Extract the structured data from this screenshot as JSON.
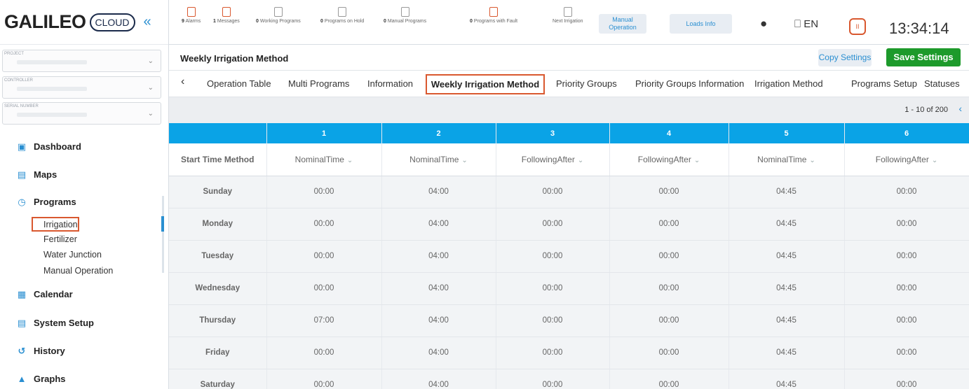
{
  "brand": {
    "name": "GALILEO",
    "cloud": "CLOUD",
    "collapse": "«"
  },
  "selectors": [
    {
      "label": "PROJECT"
    },
    {
      "label": "CONTROLLER"
    },
    {
      "label": "SERIAL NUMBER"
    }
  ],
  "nav": {
    "dashboard": "Dashboard",
    "maps": "Maps",
    "programs": "Programs",
    "irrigation": "Irrigation",
    "fertilizer": "Fertilizer",
    "water_junction": "Water Junction",
    "manual_operation": "Manual Operation",
    "calendar": "Calendar",
    "system_setup": "System Setup",
    "history": "History",
    "graphs": "Graphs"
  },
  "topbar": {
    "alarms": {
      "count": "9",
      "label": "Alarms"
    },
    "messages": {
      "count": "1",
      "label": "Messages"
    },
    "working": {
      "count": "0",
      "label": "Working Programs"
    },
    "on_hold": {
      "count": "0",
      "label": "Programs on Hold"
    },
    "manual_programs": {
      "count": "0",
      "label": "Manual Programs"
    },
    "fault": {
      "count": "0",
      "label": "Programs with Fault"
    },
    "next_irrigation": {
      "label": "Next Irrigation"
    },
    "manual_operation_btn": "Manual Operation",
    "loads_info_btn": "Loads Info",
    "language": "EN",
    "clock": "13:34:14"
  },
  "page": {
    "title": "Weekly Irrigation Method",
    "copy_settings": "Copy Settings",
    "save_settings": "Save Settings"
  },
  "tabs": [
    "Operation Table",
    "Multi Programs",
    "Information",
    "Weekly Irrigation Method",
    "Priority Groups",
    "Priority Groups Information",
    "Irrigation Method",
    "Programs Setup",
    "Statuses"
  ],
  "pager": {
    "text": "1 - 10 of 200"
  },
  "table": {
    "columns": [
      "1",
      "2",
      "3",
      "4",
      "5",
      "6"
    ],
    "method_label": "Start Time Method",
    "methods": [
      "NominalTime",
      "NominalTime",
      "FollowingAfter",
      "FollowingAfter",
      "NominalTime",
      "FollowingAfter"
    ],
    "rows": [
      {
        "day": "Sunday",
        "values": [
          "00:00",
          "04:00",
          "00:00",
          "00:00",
          "04:45",
          "00:00"
        ]
      },
      {
        "day": "Monday",
        "values": [
          "00:00",
          "04:00",
          "00:00",
          "00:00",
          "04:45",
          "00:00"
        ]
      },
      {
        "day": "Tuesday",
        "values": [
          "00:00",
          "04:00",
          "00:00",
          "00:00",
          "04:45",
          "00:00"
        ]
      },
      {
        "day": "Wednesday",
        "values": [
          "00:00",
          "04:00",
          "00:00",
          "00:00",
          "04:45",
          "00:00"
        ]
      },
      {
        "day": "Thursday",
        "values": [
          "07:00",
          "04:00",
          "00:00",
          "00:00",
          "04:45",
          "00:00"
        ]
      },
      {
        "day": "Friday",
        "values": [
          "00:00",
          "04:00",
          "00:00",
          "00:00",
          "04:45",
          "00:00"
        ]
      },
      {
        "day": "Saturday",
        "values": [
          "00:00",
          "04:00",
          "00:00",
          "00:00",
          "04:45",
          "00:00"
        ]
      }
    ]
  },
  "colors": {
    "accent": "#2a8fd1",
    "header": "#0aa3e6",
    "save": "#1d9a2b",
    "highlight": "#d9582f"
  },
  "icons": [
    "dashboard-icon",
    "map-icon",
    "clock-icon",
    "calendar-icon",
    "system-setup-icon",
    "history-icon",
    "graph-icon",
    "bell-icon",
    "user-icon",
    "globe-icon",
    "pause-icon"
  ]
}
